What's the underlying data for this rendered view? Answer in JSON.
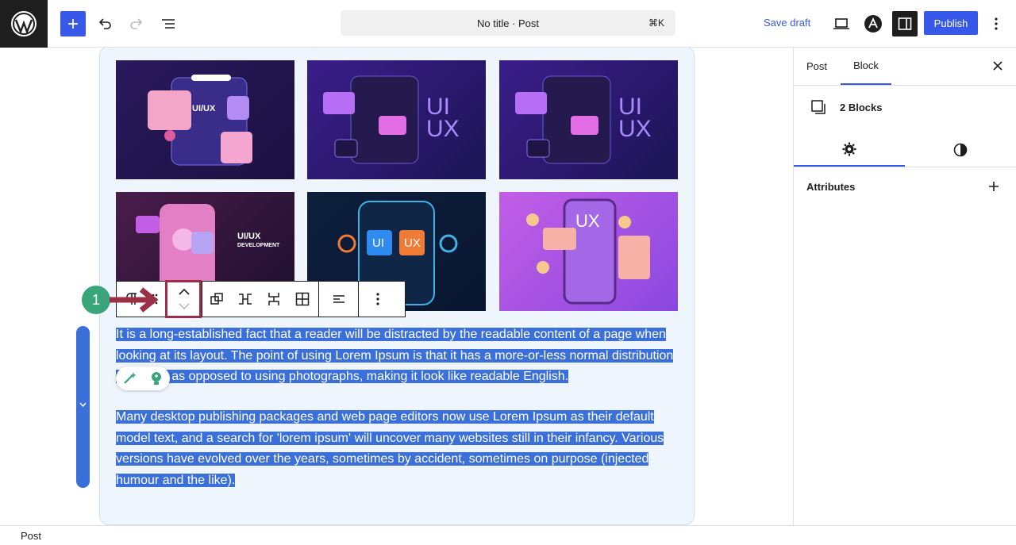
{
  "header": {
    "title": "No title · Post",
    "shortcut": "⌘K",
    "save_draft": "Save draft",
    "publish": "Publish"
  },
  "sidebar": {
    "tabs": [
      "Post",
      "Block"
    ],
    "active_tab": "Block",
    "block_summary": "2 Blocks",
    "section_title": "Attributes"
  },
  "images": [
    {
      "label": "UI/UX",
      "theme": "ui-ux-laptop"
    },
    {
      "label": "UI UX",
      "theme": "ui-ux-screens"
    },
    {
      "label": "UI UX",
      "theme": "ui-ux-screens"
    },
    {
      "label": "UI/UX",
      "sublabel": "DEVELOPMENT",
      "theme": "ui-ux-phone"
    },
    {
      "label_a": "UI",
      "label_b": "UX",
      "theme": "ui-ux-mobile-dark"
    },
    {
      "label": "UX",
      "theme": "ui-ux-phone-purple"
    }
  ],
  "paragraphs": [
    "It is a long-established fact that a reader will be distracted by the readable content of a page when looking at its layout. The point of using Lorem Ipsum is that it has a more-or-less normal distribution of letters, as opposed to using photographs, making it look like readable English.",
    "Many desktop publishing packages and web page editors now use Lorem Ipsum as their default model text, and a search for 'lorem ipsum' will uncover many websites still in their infancy. Various versions have evolved over the years, sometimes by accident, sometimes on purpose (injected humour and the like)."
  ],
  "annotation": {
    "step": "1"
  },
  "footer": {
    "breadcrumb": "Post"
  },
  "colors": {
    "accent": "#3858e9",
    "selection": "#3b6fd9",
    "annotation": "#9b2f45",
    "step_badge": "#3aa47a"
  }
}
